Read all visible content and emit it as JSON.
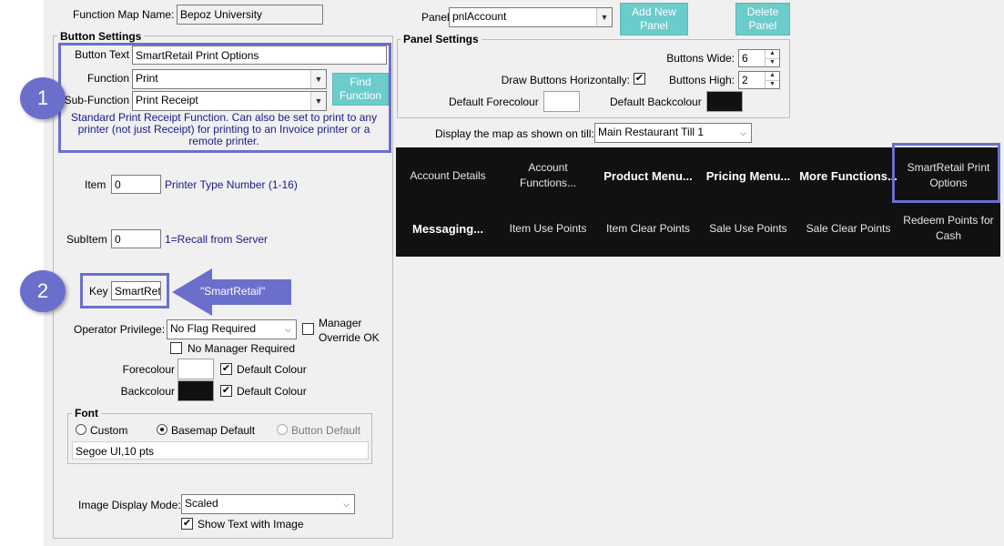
{
  "header": {
    "function_map_label": "Function Map Name:",
    "function_map_value": "Bepoz University",
    "panel_label": "Panel",
    "panel_value": "pnlAccount",
    "add_panel_button": "Add New Panel",
    "delete_panel_button": "Delete Panel"
  },
  "button_settings": {
    "title": "Button Settings",
    "button_text_label": "Button Text",
    "button_text_value": "SmartRetail Print Options",
    "function_label": "Function",
    "function_value": "Print",
    "subfunction_label": "Sub-Function",
    "subfunction_value": "Print Receipt",
    "find_function_button": "Find Function",
    "description": "Standard Print Receipt Function. Can also be set to print to any printer (not just Receipt) for printing to an Invoice printer or a remote printer.",
    "item_label": "Item",
    "item_value": "0",
    "item_hint": "Printer Type Number (1-16)",
    "subitem_label": "SubItem",
    "subitem_value": "0",
    "subitem_hint": "1=Recall from Server",
    "key_label": "Key",
    "key_value": "SmartReta",
    "operator_privilege_label": "Operator Privilege:",
    "operator_privilege_value": "No Flag Required",
    "manager_override_label": "Manager Override OK",
    "no_manager_required_label": "No Manager Required",
    "forecolour_label": "Forecolour",
    "backcolour_label": "Backcolour",
    "default_colour_label": "Default Colour",
    "font_title": "Font",
    "font_custom": "Custom",
    "font_basemap": "Basemap Default",
    "font_button": "Button Default",
    "font_value": "Segoe UI,10 pts",
    "image_display_label": "Image Display Mode:",
    "image_display_value": "Scaled",
    "show_text_label": "Show Text with Image"
  },
  "panel_settings": {
    "title": "Panel Settings",
    "buttons_wide_label": "Buttons Wide:",
    "buttons_wide_value": "6",
    "draw_horizontal_label": "Draw Buttons Horizontally:",
    "buttons_high_label": "Buttons High:",
    "buttons_high_value": "2",
    "default_forecolour_label": "Default Forecolour",
    "default_backcolour_label": "Default Backcolour"
  },
  "display_map": {
    "label": "Display the map as shown on till:",
    "value": "Main Restaurant Till 1"
  },
  "grid_buttons": [
    "Account Details",
    "Account Functions...",
    "Product Menu...",
    "Pricing Menu...",
    "More Functions...",
    "SmartRetail Print Options",
    "Messaging...",
    "Item Use Points",
    "Item Clear Points",
    "Sale Use Points",
    "Sale Clear Points",
    "Redeem Points for Cash"
  ],
  "annotations": {
    "bubble_1": "1",
    "bubble_2": "2",
    "arrow_text": "\"SmartRetail\""
  },
  "colors": {
    "accent": "#6b6fcc",
    "teal_button": "#6ccbcb",
    "tile_bg": "#111111",
    "description_text": "#1a1a8c"
  }
}
